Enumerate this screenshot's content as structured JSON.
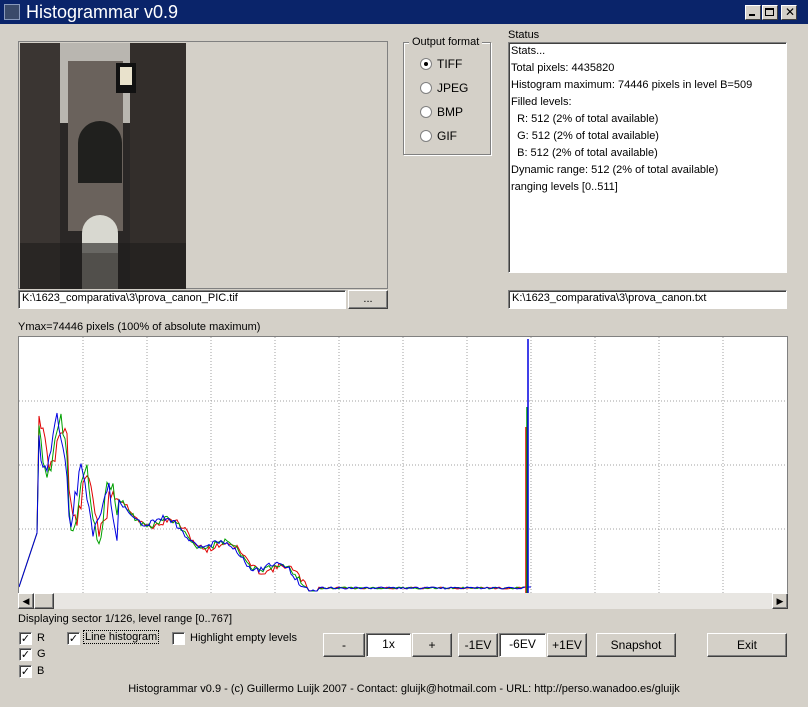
{
  "window": {
    "title": "Histogrammar v0.9",
    "controls": {
      "minimize": "minimize-icon",
      "maximize": "maximize-icon",
      "close": "close-icon"
    }
  },
  "preview": {
    "image_path": "K:\\1623_comparativa\\3\\prova_canon_PIC.tif",
    "browse_label": "..."
  },
  "output_format": {
    "group_label": "Output format",
    "options": [
      "TIFF",
      "JPEG",
      "BMP",
      "GIF"
    ],
    "selected": "TIFF"
  },
  "status": {
    "label": "Status",
    "lines": [
      "Stats...",
      "Total pixels: 4435820",
      "Histogram maximum: 74446 pixels in level B=509",
      "Filled levels:",
      "  R: 512 (2% of total available)",
      "  G: 512 (2% of total available)",
      "  B: 512 (2% of total available)",
      "Dynamic range: 512 (2% of total available)",
      "ranging levels [0..511]"
    ],
    "output_path": "K:\\1623_comparativa\\3\\prova_canon.txt"
  },
  "histogram": {
    "ymax_label": "Ymax=74446 pixels (100% of absolute maximum)",
    "sector_label": "Displaying sector 1/126, level range [0..767]",
    "colors": {
      "r": "#e00000",
      "g": "#00a000",
      "b": "#0000e0",
      "grid": "#a0a0a0"
    }
  },
  "controls": {
    "check_r": "R",
    "check_g": "G",
    "check_b": "B",
    "line_histogram": "Line histogram",
    "highlight_empty": "Highlight empty levels",
    "zoom_minus": "-",
    "zoom_value": "1x",
    "zoom_plus": "+",
    "ev_minus": "-1EV",
    "ev_value": "-6EV",
    "ev_plus": "+1EV",
    "snapshot": "Snapshot",
    "exit": "Exit"
  },
  "footer": "Histogrammar v0.9 - (c) Guillermo Luijk 2007 - Contact: gluijk@hotmail.com - URL: http://perso.wanadoo.es/gluijk"
}
